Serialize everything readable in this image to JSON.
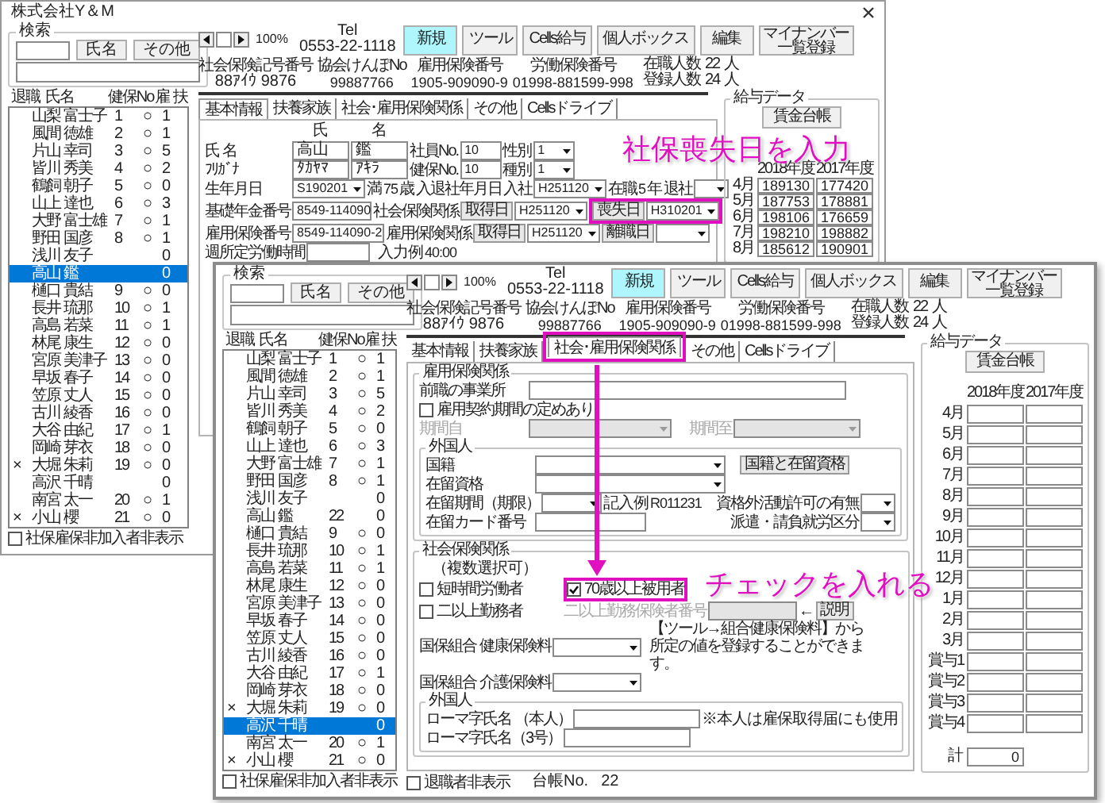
{
  "back_window": {
    "title": "株式会社Y＆M",
    "search": {
      "legend": "検索",
      "buttons": [
        "氏名",
        "その他"
      ]
    },
    "list_columns": [
      "退職",
      "氏名",
      "健保No",
      "雇",
      "扶"
    ],
    "employees": [
      {
        "name": "山梨 富士子",
        "kenpo": "1",
        "koyo": "○",
        "fuyo": "1",
        "selected": false
      },
      {
        "name": "風間 徳雄",
        "kenpo": "2",
        "koyo": "○",
        "fuyo": "1",
        "selected": false
      },
      {
        "name": "片山 幸司",
        "kenpo": "3",
        "koyo": "○",
        "fuyo": "5",
        "selected": false
      },
      {
        "name": "皆川 秀美",
        "kenpo": "4",
        "koyo": "○",
        "fuyo": "2",
        "selected": false
      },
      {
        "name": "鶴飼 朝子",
        "kenpo": "5",
        "koyo": "○",
        "fuyo": "0",
        "selected": false
      },
      {
        "name": "山上 達也",
        "kenpo": "6",
        "koyo": "○",
        "fuyo": "3",
        "selected": false
      },
      {
        "name": "大野 富士雄",
        "kenpo": "7",
        "koyo": "○",
        "fuyo": "1",
        "selected": false
      },
      {
        "name": "野田 国彦",
        "kenpo": "8",
        "koyo": "○",
        "fuyo": "1",
        "selected": false
      },
      {
        "name": "浅川 友子",
        "fuyo": "0",
        "selected": false
      },
      {
        "name": "高山 鑑",
        "fuyo": "0",
        "selected": true
      },
      {
        "name": "樋口 貴結",
        "kenpo": "9",
        "koyo": "○",
        "fuyo": "0",
        "selected": false
      },
      {
        "name": "長井 琉那",
        "kenpo": "10",
        "koyo": "○",
        "fuyo": "1",
        "selected": false
      },
      {
        "name": "高島 若菜",
        "kenpo": "11",
        "koyo": "○",
        "fuyo": "1",
        "selected": false
      },
      {
        "name": "林尾 康生",
        "kenpo": "12",
        "koyo": "○",
        "fuyo": "0",
        "selected": false
      },
      {
        "name": "宮原 美津子",
        "kenpo": "13",
        "koyo": "○",
        "fuyo": "0",
        "selected": false
      },
      {
        "name": "早坂 春子",
        "kenpo": "14",
        "koyo": "○",
        "fuyo": "0",
        "selected": false
      },
      {
        "name": "笠原 丈人",
        "kenpo": "15",
        "koyo": "○",
        "fuyo": "0",
        "selected": false
      },
      {
        "name": "古川 綾香",
        "kenpo": "16",
        "koyo": "○",
        "fuyo": "0",
        "selected": false
      },
      {
        "name": "大谷 由紀",
        "kenpo": "17",
        "koyo": "○",
        "fuyo": "1",
        "selected": false
      },
      {
        "name": "岡崎 芽衣",
        "kenpo": "18",
        "koyo": "○",
        "fuyo": "0",
        "selected": false
      },
      {
        "mark": "×",
        "name": "大堀 朱莉",
        "kenpo": "19",
        "koyo": "○",
        "fuyo": "0",
        "selected": false
      },
      {
        "name": "高沢 千晴",
        "fuyo": "0",
        "selected": false
      },
      {
        "name": "南宮 太一",
        "kenpo": "20",
        "koyo": "○",
        "fuyo": "1",
        "selected": false
      },
      {
        "mark": "×",
        "name": "小山 櫻",
        "kenpo": "21",
        "koyo": "○",
        "fuyo": "0",
        "selected": false
      }
    ],
    "hide_uninsured": {
      "text": "社保雇保非加入者非表示",
      "checked": false
    },
    "toolbar": {
      "zoom": "100%",
      "tel_label": "Tel",
      "tel": "0553-22-1118",
      "buttons": [
        {
          "label": "新規",
          "active": true
        },
        {
          "label": "ツール",
          "active": false
        },
        {
          "label": "Cells給与",
          "active": false
        },
        {
          "label": "個人ボックス",
          "active": false
        },
        {
          "label": "編集",
          "active": false
        },
        {
          "label": "マイナンバー一覧登録",
          "active": false
        }
      ]
    },
    "info": [
      {
        "label": "社会保険記号番号",
        "value": "88ｱｲｳ 9876"
      },
      {
        "label": "協会けんぽNo",
        "value": "99887766"
      },
      {
        "label": "雇用保険番号",
        "value": "1905-909090-9"
      },
      {
        "label": "労働保険番号",
        "value": "01998-881599-998"
      }
    ],
    "counts": [
      {
        "label": "在職人数",
        "value": "22",
        "unit": "人"
      },
      {
        "label": "登録人数",
        "value": "24",
        "unit": "人"
      }
    ],
    "tabs": [
      {
        "label": "基本情報",
        "selected": true
      },
      {
        "label": "扶養家族",
        "selected": false
      },
      {
        "label": "社会･雇用保険関係",
        "selected": false
      },
      {
        "label": "その他",
        "selected": false
      },
      {
        "label": "Cellsドライブ",
        "selected": false
      }
    ],
    "form": {
      "rows": [
        {
          "items": [
            {
              "kind": "head",
              "text": "氏"
            },
            {
              "kind": "head",
              "text": "名"
            }
          ]
        },
        {
          "items": [
            {
              "kind": "label",
              "text": "氏 名"
            },
            {
              "kind": "field",
              "value": "高山"
            },
            {
              "kind": "field",
              "value": "鑑"
            },
            {
              "kind": "label",
              "text": "社員No."
            },
            {
              "kind": "field",
              "value": "10"
            },
            {
              "kind": "label",
              "text": "性別"
            },
            {
              "kind": "combo",
              "value": "1"
            }
          ]
        },
        {
          "items": [
            {
              "kind": "label",
              "text": "ﾌﾘｶﾞﾅ"
            },
            {
              "kind": "field",
              "value": "ﾀｶﾔﾏ"
            },
            {
              "kind": "field",
              "value": "ｱｷﾗ"
            },
            {
              "kind": "label",
              "text": "健保No."
            },
            {
              "kind": "field",
              "value": "10"
            },
            {
              "kind": "label",
              "text": "種別"
            },
            {
              "kind": "combo",
              "value": "1"
            }
          ]
        },
        {
          "items": [
            {
              "kind": "label",
              "text": "生年月日"
            },
            {
              "kind": "combo",
              "value": "S190201"
            },
            {
              "kind": "text",
              "text": "満"
            },
            {
              "kind": "text",
              "text": "75"
            },
            {
              "kind": "text",
              "text": "歳"
            },
            {
              "kind": "label",
              "text": "入退社年月日"
            },
            {
              "kind": "label",
              "text": "入社"
            },
            {
              "kind": "combo",
              "value": "H251120"
            },
            {
              "kind": "label",
              "text": "在職"
            },
            {
              "kind": "text",
              "text": "5"
            },
            {
              "kind": "text",
              "text": "年"
            },
            {
              "kind": "label",
              "text": "退社"
            },
            {
              "kind": "combo"
            }
          ]
        },
        {
          "items": [
            {
              "kind": "label",
              "text": "基礎年金番号"
            },
            {
              "kind": "field",
              "value": "8549-114090"
            },
            {
              "kind": "label",
              "text": "社会保険関係"
            },
            {
              "kind": "button",
              "text": "取得日"
            },
            {
              "kind": "combo",
              "value": "H251120"
            },
            {
              "kind": "button",
              "text": "喪失日",
              "highlighted": true
            },
            {
              "kind": "combo",
              "value": "H310201",
              "highlighted": true
            }
          ]
        },
        {
          "items": [
            {
              "kind": "label",
              "text": "雇用保険番号"
            },
            {
              "kind": "field",
              "value": "8549-114090-2"
            },
            {
              "kind": "label",
              "text": "雇用保険関係"
            },
            {
              "kind": "button",
              "text": "取得日"
            },
            {
              "kind": "combo",
              "value": "H251120"
            },
            {
              "kind": "button",
              "text": "離職日"
            },
            {
              "kind": "combo"
            }
          ]
        },
        {
          "items": [
            {
              "kind": "label",
              "text": "週所定労働時間"
            },
            {
              "kind": "field"
            },
            {
              "kind": "text",
              "text": "入力例"
            },
            {
              "kind": "text",
              "text": "40:00"
            }
          ]
        }
      ]
    },
    "salary": {
      "legend": "給与データ",
      "button": "賃金台帳",
      "years": [
        "2018年度",
        "2017年度"
      ],
      "rows": [
        {
          "month": "4月",
          "values": [
            "189130",
            "177420"
          ]
        },
        {
          "month": "5月",
          "values": [
            "187753",
            "178881"
          ]
        },
        {
          "month": "6月",
          "values": [
            "198106",
            "176659"
          ]
        },
        {
          "month": "7月",
          "values": [
            "198210",
            "198882"
          ]
        },
        {
          "month": "8月",
          "values": [
            "185612",
            "190901"
          ]
        }
      ]
    }
  },
  "front_window": {
    "search": {
      "legend": "検索",
      "buttons": [
        "氏名",
        "その他"
      ]
    },
    "list_columns": [
      "退職",
      "氏名",
      "健保No",
      "雇",
      "扶"
    ],
    "employees": [
      {
        "name": "山梨 富士子",
        "kenpo": "1",
        "koyo": "○",
        "fuyo": "1",
        "selected": false
      },
      {
        "name": "風間 徳雄",
        "kenpo": "2",
        "koyo": "○",
        "fuyo": "1",
        "selected": false
      },
      {
        "name": "片山 幸司",
        "kenpo": "3",
        "koyo": "○",
        "fuyo": "5",
        "selected": false
      },
      {
        "name": "皆川 秀美",
        "kenpo": "4",
        "koyo": "○",
        "fuyo": "2",
        "selected": false
      },
      {
        "name": "鶴飼 朝子",
        "kenpo": "5",
        "koyo": "○",
        "fuyo": "0",
        "selected": false
      },
      {
        "name": "山上 達也",
        "kenpo": "6",
        "koyo": "○",
        "fuyo": "3",
        "selected": false
      },
      {
        "name": "大野 富士雄",
        "kenpo": "7",
        "koyo": "○",
        "fuyo": "1",
        "selected": false
      },
      {
        "name": "野田 国彦",
        "kenpo": "8",
        "koyo": "○",
        "fuyo": "1",
        "selected": false
      },
      {
        "name": "浅川 友子",
        "fuyo": "0",
        "selected": false
      },
      {
        "name": "高山 鑑",
        "kenpo": "22",
        "fuyo": "0",
        "selected": false
      },
      {
        "name": "樋口 貴結",
        "kenpo": "9",
        "koyo": "○",
        "fuyo": "0",
        "selected": false
      },
      {
        "name": "長井 琉那",
        "kenpo": "10",
        "koyo": "○",
        "fuyo": "1",
        "selected": false
      },
      {
        "name": "高島 若菜",
        "kenpo": "11",
        "koyo": "○",
        "fuyo": "1",
        "selected": false
      },
      {
        "name": "林尾 康生",
        "kenpo": "12",
        "koyo": "○",
        "fuyo": "0",
        "selected": false
      },
      {
        "name": "宮原 美津子",
        "kenpo": "13",
        "koyo": "○",
        "fuyo": "0",
        "selected": false
      },
      {
        "name": "早坂 春子",
        "kenpo": "14",
        "koyo": "○",
        "fuyo": "0",
        "selected": false
      },
      {
        "name": "笠原 丈人",
        "kenpo": "15",
        "koyo": "○",
        "fuyo": "0",
        "selected": false
      },
      {
        "name": "古川 綾香",
        "kenpo": "16",
        "koyo": "○",
        "fuyo": "0",
        "selected": false
      },
      {
        "name": "大谷 由紀",
        "kenpo": "17",
        "koyo": "○",
        "fuyo": "1",
        "selected": false
      },
      {
        "name": "岡崎 芽衣",
        "kenpo": "18",
        "koyo": "○",
        "fuyo": "0",
        "selected": false
      },
      {
        "mark": "×",
        "name": "大堀 朱莉",
        "kenpo": "19",
        "koyo": "○",
        "fuyo": "0",
        "selected": false
      },
      {
        "name": "高沢 千晴",
        "fuyo": "0",
        "selected": true
      },
      {
        "name": "南宮 太一",
        "kenpo": "20",
        "koyo": "○",
        "fuyo": "1",
        "selected": false
      },
      {
        "mark": "×",
        "name": "小山 櫻",
        "kenpo": "21",
        "koyo": "○",
        "fuyo": "0",
        "selected": false
      }
    ],
    "hide_uninsured": {
      "text": "社保雇保非加入者非表示",
      "checked": false
    },
    "toolbar": {
      "zoom": "100%",
      "tel_label": "Tel",
      "tel": "0553-22-1118",
      "buttons": [
        {
          "label": "新規",
          "active": true
        },
        {
          "label": "ツール",
          "active": false
        },
        {
          "label": "Cells給与",
          "active": false
        },
        {
          "label": "個人ボックス",
          "active": false
        },
        {
          "label": "編集",
          "active": false
        },
        {
          "label": "マイナンバー一覧登録",
          "active": false
        }
      ]
    },
    "info": [
      {
        "label": "社会保険記号番号",
        "value": "88ｱｲｳ 9876"
      },
      {
        "label": "協会けんぽNo",
        "value": "99887766"
      },
      {
        "label": "雇用保険番号",
        "value": "1905-909090-9"
      },
      {
        "label": "労働保険番号",
        "value": "01998-881599-998"
      }
    ],
    "counts": [
      {
        "label": "在職人数",
        "value": "22",
        "unit": "人"
      },
      {
        "label": "登録人数",
        "value": "24",
        "unit": "人"
      }
    ],
    "tabs": [
      {
        "label": "基本情報",
        "selected": false
      },
      {
        "label": "扶養家族",
        "selected": false
      },
      {
        "label": "社会･雇用保険関係",
        "selected": true,
        "highlighted": true
      },
      {
        "label": "その他",
        "selected": false
      },
      {
        "label": "Cellsドライブ",
        "selected": false
      }
    ],
    "form": {
      "groups": [
        {
          "legend": "雇用保険関係",
          "rows": [
            {
              "items": [
                {
                  "kind": "label",
                  "text": "前職の事業所"
                },
                {
                  "kind": "field"
                }
              ]
            },
            {
              "items": [
                {
                  "kind": "check",
                  "text": "雇用契約期間の定めあり",
                  "checked": false
                }
              ]
            },
            {
              "items": [
                {
                  "kind": "label",
                  "text": "期間自",
                  "disabled": true
                },
                {
                  "kind": "combo",
                  "disabled": true
                },
                {
                  "kind": "label",
                  "text": "期間至",
                  "disabled": true
                },
                {
                  "kind": "combo",
                  "disabled": true
                }
              ]
            }
          ],
          "subgroup": {
            "legend": "外国人",
            "rows": [
              {
                "items": [
                  {
                    "kind": "label",
                    "text": "国籍"
                  },
                  {
                    "kind": "combo"
                  },
                  {
                    "kind": "button",
                    "text": "国籍と在留資格"
                  }
                ]
              },
              {
                "items": [
                  {
                    "kind": "label",
                    "text": "在留資格"
                  },
                  {
                    "kind": "combo"
                  }
                ]
              },
              {
                "items": [
                  {
                    "kind": "label",
                    "text": "在留期間（期限）"
                  },
                  {
                    "kind": "combo"
                  },
                  {
                    "kind": "text",
                    "text": "記入例"
                  },
                  {
                    "kind": "text",
                    "text": "R011231"
                  },
                  {
                    "kind": "label",
                    "text": "資格外活動許可の有無"
                  },
                  {
                    "kind": "combo"
                  }
                ]
              },
              {
                "items": [
                  {
                    "kind": "label",
                    "text": "在留カード番号"
                  },
                  {
                    "kind": "field"
                  },
                  {
                    "kind": "label",
                    "text": "派遣・請負就労区分"
                  },
                  {
                    "kind": "combo"
                  }
                ]
              }
            ]
          }
        },
        {
          "legend": "社会保険関係",
          "rows": [
            {
              "items": [
                {
                  "kind": "text",
                  "text": "（複数選択可）"
                }
              ]
            },
            {
              "items": [
                {
                  "kind": "check",
                  "text": "短時間労働者",
                  "checked": false
                },
                {
                  "kind": "check",
                  "text": "70歳以上被用者",
                  "checked": true,
                  "highlighted": true
                }
              ]
            },
            {
              "items": [
                {
                  "kind": "check",
                  "text": "二以上勤務者",
                  "checked": false
                },
                {
                  "kind": "label",
                  "text": "二以上勤務保険者番号",
                  "disabled": true
                },
                {
                  "kind": "field",
                  "disabled": true
                },
                {
                  "kind": "text",
                  "text": "←"
                },
                {
                  "kind": "button",
                  "text": "説明"
                }
              ]
            },
            {
              "items": [
                {
                  "kind": "label",
                  "text": "国保組合 健康保険料"
                },
                {
                  "kind": "combo"
                },
                {
                  "kind": "note",
                  "text": "【ツール→組合健康保険料】から所定の値を登録することができます。"
                }
              ]
            },
            {
              "items": [
                {
                  "kind": "label",
                  "text": "国保組合 介護保険料"
                },
                {
                  "kind": "combo"
                }
              ]
            }
          ],
          "subgroup": {
            "legend": "外国人",
            "rows": [
              {
                "items": [
                  {
                    "kind": "label",
                    "text": "ローマ字氏名 （本人）"
                  },
                  {
                    "kind": "field"
                  },
                  {
                    "kind": "text",
                    "text": "※本人は雇保取得届にも使用"
                  }
                ]
              },
              {
                "items": [
                  {
                    "kind": "label",
                    "text": "ローマ字氏名（3号）"
                  },
                  {
                    "kind": "field"
                  }
                ]
              }
            ]
          }
        }
      ]
    },
    "footer": {
      "retired_hidden": {
        "text": "退職者非表示",
        "checked": false
      },
      "ledger_label": "台帳No.",
      "ledger_no": "22"
    },
    "salary": {
      "legend": "給与データ",
      "button": "賃金台帳",
      "years": [
        "2018年度",
        "2017年度"
      ],
      "rows": [
        {
          "month": "4月"
        },
        {
          "month": "5月"
        },
        {
          "month": "6月"
        },
        {
          "month": "7月"
        },
        {
          "month": "8月"
        },
        {
          "month": "9月"
        },
        {
          "month": "10月"
        },
        {
          "month": "11月"
        },
        {
          "month": "12月"
        },
        {
          "month": "1月"
        },
        {
          "month": "2月"
        },
        {
          "month": "3月"
        },
        {
          "month": "賞与1"
        },
        {
          "month": "賞与2"
        },
        {
          "month": "賞与3"
        },
        {
          "month": "賞与4"
        }
      ],
      "total": {
        "label": "計",
        "value": "0"
      }
    }
  },
  "annotations": [
    {
      "text": "社保喪失日を入力"
    },
    {
      "text": "チェックを入れる"
    }
  ]
}
